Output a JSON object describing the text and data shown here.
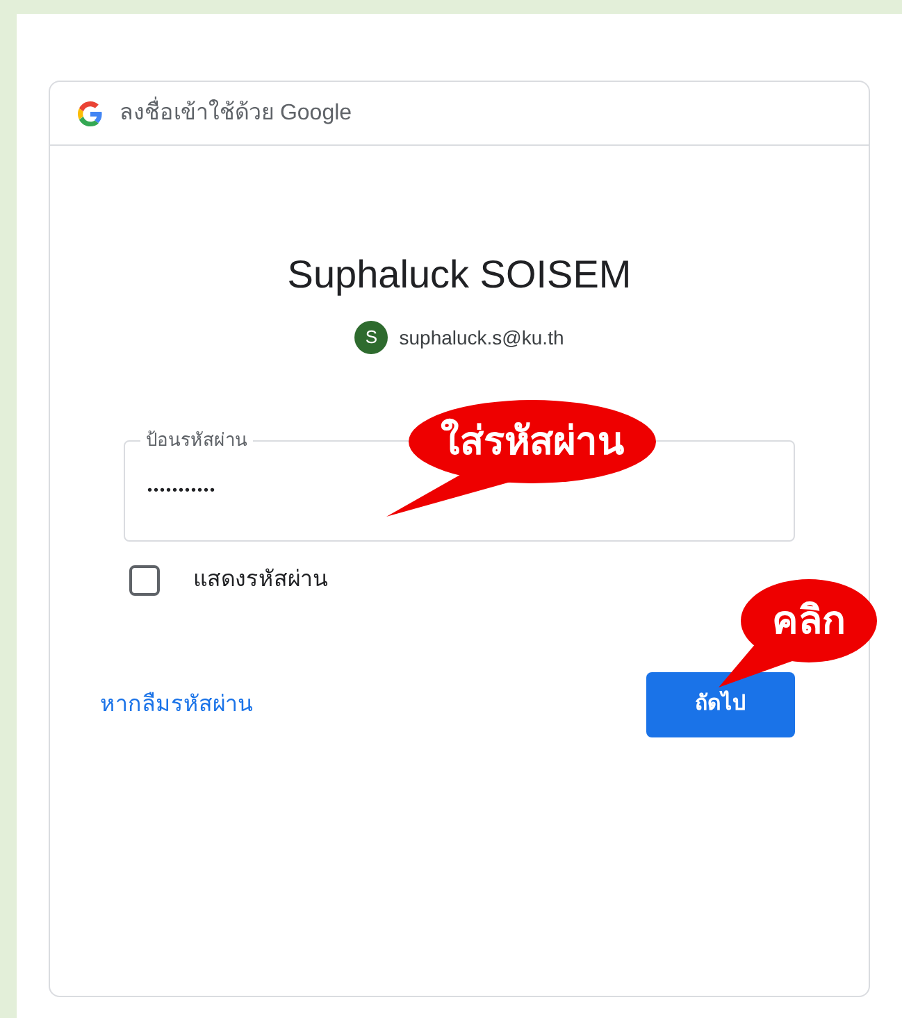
{
  "card": {
    "header": "ลงชื่อเข้าใช้ด้วย Google",
    "name": "Suphaluck SOISEM",
    "account": {
      "avatar_letter": "S",
      "email": "suphaluck.s@ku.th"
    },
    "password_field": {
      "label": "ป้อนรหัสผ่าน",
      "value": "•••••••••••"
    },
    "show_password": {
      "label": "แสดงรหัสผ่าน",
      "checked": false
    },
    "forgot_link": "หากลืมรหัสผ่าน",
    "next_button": "ถัดไป"
  },
  "callouts": [
    {
      "text": "ใส่รหัสผ่าน"
    },
    {
      "text": "คลิก"
    }
  ]
}
